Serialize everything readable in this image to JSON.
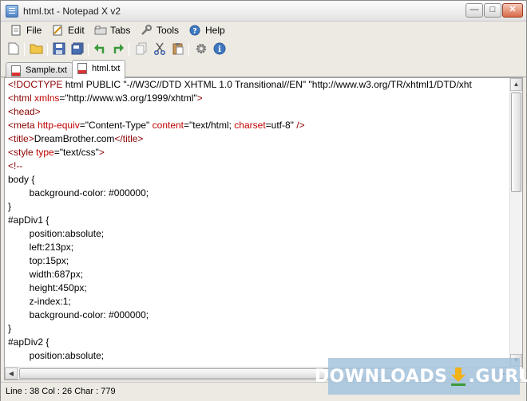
{
  "window": {
    "title": "html.txt - Notepad X v2"
  },
  "menu": {
    "file": "File",
    "edit": "Edit",
    "tabs": "Tabs",
    "tools": "Tools",
    "help": "Help"
  },
  "tabs": [
    {
      "label": "Sample.txt",
      "active": false
    },
    {
      "label": "html.txt",
      "active": true
    }
  ],
  "editor": {
    "lines": [
      "<!DOCTYPE html PUBLIC \"-//W3C//DTD XHTML 1.0 Transitional//EN\" \"http://www.w3.org/TR/xhtml1/DTD/xht",
      "<html xmlns=\"http://www.w3.org/1999/xhtml\">",
      "<head>",
      "<meta http-equiv=\"Content-Type\" content=\"text/html; charset=utf-8\" />",
      "<title>DreamBrother.com</title>",
      "<style type=\"text/css\">",
      "<!--",
      "body {",
      "\tbackground-color: #000000;",
      "}",
      "#apDiv1 {",
      "\tposition:absolute;",
      "\tleft:213px;",
      "\ttop:15px;",
      "\twidth:687px;",
      "\theight:450px;",
      "\tz-index:1;",
      "\tbackground-color: #000000;",
      "}",
      "#apDiv2 {",
      "\tposition:absolute;"
    ]
  },
  "status": {
    "text": "Line : 38 Col : 26 Char : 779"
  },
  "watermark": {
    "text": "DOWNLOADS",
    "suffix": ".GURU"
  },
  "icons": {
    "new": "new-file-icon",
    "open": "open-folder-icon",
    "save": "save-icon",
    "save_all": "save-all-icon",
    "undo": "undo-icon",
    "redo": "redo-icon",
    "copy": "copy-icon",
    "cut": "cut-icon",
    "paste": "paste-icon",
    "settings": "gear-icon",
    "about": "info-icon"
  },
  "colors": {
    "markup": "#8b0000",
    "attribute": "#c00000",
    "text": "#000000"
  }
}
